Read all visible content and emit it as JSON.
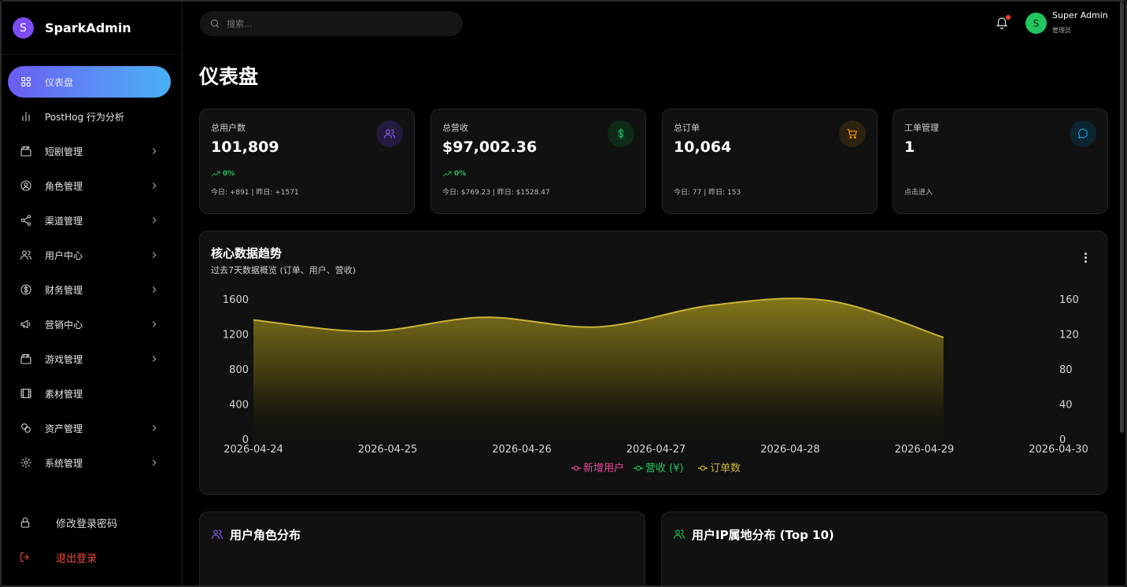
{
  "brand": {
    "logo_letter": "S",
    "name": "SparkAdmin"
  },
  "sidebar": {
    "items": [
      {
        "label": "仪表盘",
        "icon": "dashboard-grid-icon",
        "active": true,
        "has_chevron": false
      },
      {
        "label": "PostHog 行为分析",
        "icon": "bar-chart-icon",
        "active": false,
        "has_chevron": false
      },
      {
        "label": "短剧管理",
        "icon": "clapperboard-icon",
        "active": false,
        "has_chevron": true
      },
      {
        "label": "角色管理",
        "icon": "user-circle-icon",
        "active": false,
        "has_chevron": true
      },
      {
        "label": "渠道管理",
        "icon": "share-nodes-icon",
        "active": false,
        "has_chevron": true
      },
      {
        "label": "用户中心",
        "icon": "users-icon",
        "active": false,
        "has_chevron": true
      },
      {
        "label": "财务管理",
        "icon": "dollar-circle-icon",
        "active": false,
        "has_chevron": true
      },
      {
        "label": "营销中心",
        "icon": "megaphone-icon",
        "active": false,
        "has_chevron": true
      },
      {
        "label": "游戏管理",
        "icon": "clapperboard-icon",
        "active": false,
        "has_chevron": true
      },
      {
        "label": "素材管理",
        "icon": "film-icon",
        "active": false,
        "has_chevron": false
      },
      {
        "label": "资产管理",
        "icon": "coins-icon",
        "active": false,
        "has_chevron": true
      },
      {
        "label": "系统管理",
        "icon": "gear-icon",
        "active": false,
        "has_chevron": true
      }
    ],
    "change_password": "修改登录密码",
    "logout": "退出登录"
  },
  "header": {
    "search_placeholder": "搜索...",
    "user": {
      "avatar_letter": "S",
      "name": "Super Admin",
      "role": "管理员"
    }
  },
  "page": {
    "title": "仪表盘"
  },
  "stats": [
    {
      "label": "总用户数",
      "value": "101,809",
      "trend": "0%",
      "sub": "今日: +891 | 昨日: +1571",
      "icon": "users-icon",
      "color": "#8b5cf6",
      "bg": "#231a3d"
    },
    {
      "label": "总营收",
      "value": "$97,002.36",
      "trend": "0%",
      "sub": "今日: $769.23 | 昨日: $1528.47",
      "icon": "dollar-icon",
      "color": "#22c55e",
      "bg": "#0f2a19"
    },
    {
      "label": "总订单",
      "value": "10,064",
      "trend": "",
      "sub": "今日: 77 | 昨日: 153",
      "icon": "cart-icon",
      "color": "#f59e0b",
      "bg": "#2e2210"
    },
    {
      "label": "工单管理",
      "value": "1",
      "trend": "",
      "sub": "点击进入",
      "icon": "chat-bubble-icon",
      "color": "#0ea5e9",
      "bg": "#0d2431"
    }
  ],
  "chart": {
    "title": "核心数据趋势",
    "subtitle": "过去7天数据概览 (订单、用户、营收)"
  },
  "chart_data": {
    "type": "area",
    "categories": [
      "2026-04-24",
      "2026-04-25",
      "2026-04-26",
      "2026-04-27",
      "2026-04-28",
      "2026-04-29",
      "2026-04-30"
    ],
    "y_left_ticks": [
      "0",
      "400",
      "800",
      "1200",
      "1600"
    ],
    "y_right_ticks": [
      "0",
      "40",
      "80",
      "120",
      "160"
    ],
    "ylim_left": [
      0,
      1600
    ],
    "ylim_right": [
      0,
      160
    ],
    "series": [
      {
        "name": "新增用户",
        "color": "#ec4899",
        "axis": "left",
        "values": []
      },
      {
        "name": "营收 (¥)",
        "color": "#22c55e",
        "axis": "left",
        "values": []
      },
      {
        "name": "订单数",
        "color": "#c9b437",
        "axis": "right",
        "values": [
          137,
          124,
          140,
          129,
          154,
          159,
          117
        ]
      }
    ],
    "legend_position": "bottom-center",
    "grid": false
  },
  "bottom_cards": [
    {
      "title": "用户角色分布",
      "icon": "users-icon",
      "color": "#8b5cf6"
    },
    {
      "title": "用户IP属地分布 (Top 10)",
      "icon": "users-icon",
      "color": "#22c55e"
    }
  ]
}
